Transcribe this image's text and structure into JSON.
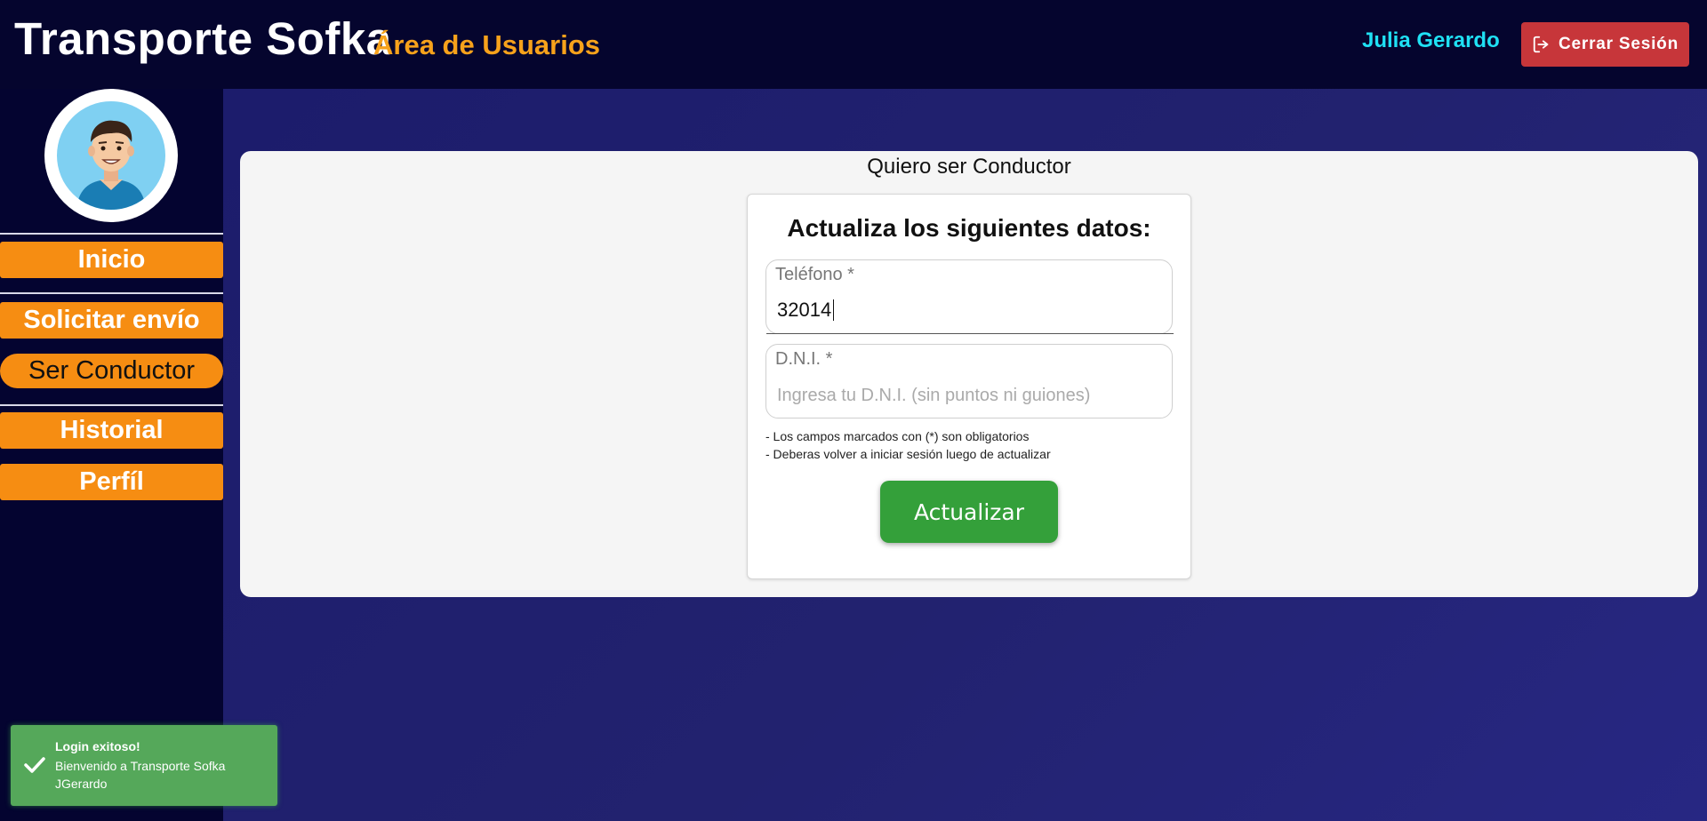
{
  "header": {
    "brand": "Transporte Sofka",
    "subtitle": "Área de Usuarios",
    "user_name": "Julia Gerardo",
    "logout_label": "Cerrar Sesión",
    "logout_icon": "logout-icon"
  },
  "sidebar": {
    "avatar": "user-avatar",
    "items": [
      {
        "label": "Inicio"
      },
      {
        "label": "Solicitar envío"
      },
      {
        "label": "Ser Conductor"
      },
      {
        "label": "Historial"
      },
      {
        "label": "Perfíl"
      }
    ],
    "active_item": "Ser Conductor"
  },
  "main": {
    "section_title": "Quiero ser Conductor",
    "form": {
      "title": "Actualiza los siguientes datos:",
      "phone": {
        "label": "Teléfono *",
        "value": "32014"
      },
      "dni": {
        "label": "D.N.I. *",
        "value": "",
        "placeholder": "Ingresa tu D.N.I. (sin puntos ni guiones)"
      },
      "notes": [
        "- Los campos marcados con (*) son obligatorios",
        "- Deberas volver a iniciar sesión luego de actualizar"
      ],
      "submit_label": "Actualizar"
    }
  },
  "toast": {
    "title": "Login exitoso!",
    "message": "Bienvenido a Transporte Sofka JGerardo",
    "icon": "check-icon"
  },
  "colors": {
    "header_bg": "#05052e",
    "accent_orange": "#f68d12",
    "subtitle_orange": "#f7a21b",
    "user_cyan": "#1fe1f4",
    "logout_red": "#c7363a",
    "submit_green": "#34a03a",
    "toast_green": "#55a85a"
  }
}
